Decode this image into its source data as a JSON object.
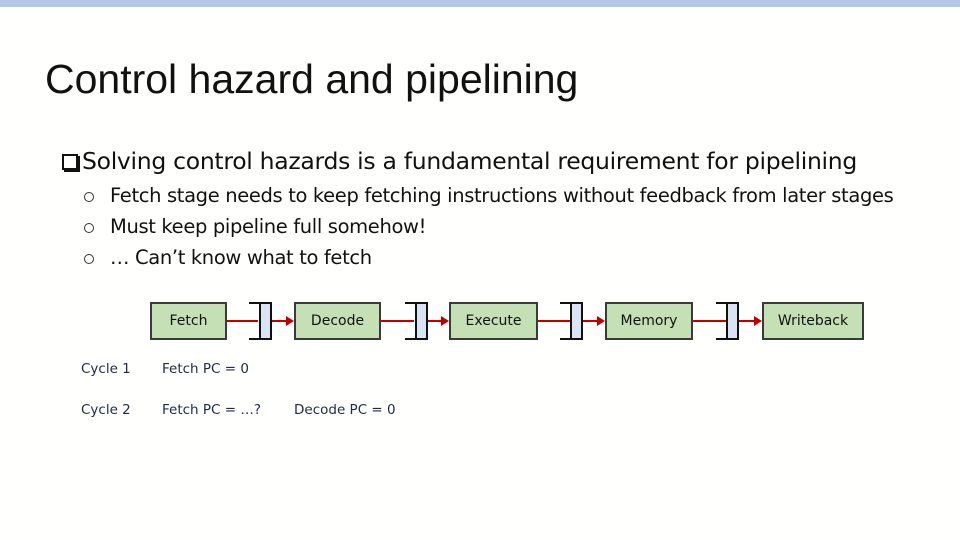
{
  "slide": {
    "title": "Control hazard and pipelining",
    "accent_bar_color": "#b4c6e7",
    "bullets": {
      "level1": {
        "icon": "checkbox-square-icon",
        "text": "Solving control hazards is a fundamental requirement for pipelining"
      },
      "level2": [
        {
          "icon": "hollow-circle-icon",
          "text": "Fetch stage needs to keep fetching instructions without feedback from later stages"
        },
        {
          "icon": "hollow-circle-icon",
          "text": "Must keep pipeline full somehow!"
        },
        {
          "icon": "hollow-circle-icon",
          "text": "… Can’t know what to fetch"
        }
      ]
    },
    "pipeline": {
      "stage_color": "#c5e0b4",
      "register_color": "#dae3f3",
      "wire_color": "#c00000",
      "stages": [
        "Fetch",
        "Decode",
        "Execute",
        "Memory",
        "Writeback"
      ]
    },
    "cycles": [
      {
        "label": "Cycle 1",
        "entries": [
          "Fetch PC = 0"
        ]
      },
      {
        "label": "Cycle 2",
        "entries": [
          "Fetch PC = …?",
          "Decode PC = 0"
        ]
      }
    ]
  }
}
